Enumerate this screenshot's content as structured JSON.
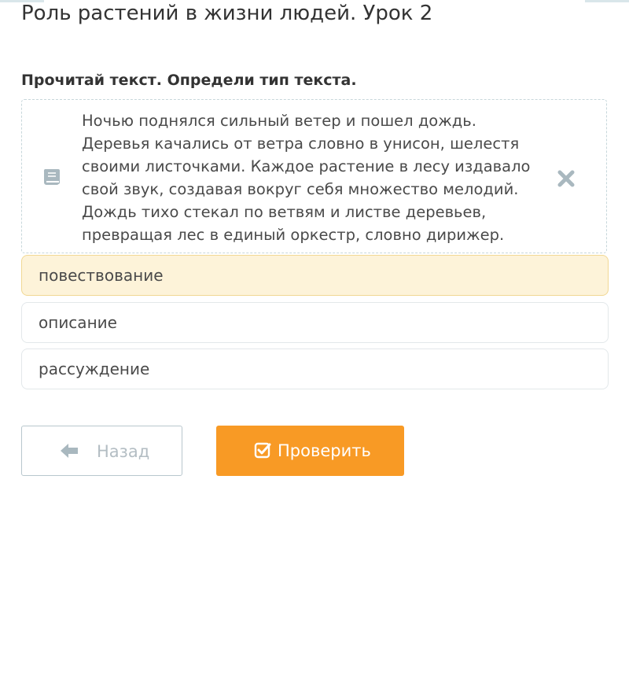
{
  "lesson": {
    "title": "Роль растений в жизни людей. Урок 2"
  },
  "task": {
    "instruction": "Прочитай текст. Определи тип текста.",
    "passage": "Ночью поднялся сильный ветер и пошел дождь. Деревья качались от ветра словно в унисон, шелестя своими листочками. Каждое растение в лесу издавало свой звук, создавая вокруг себя множество мелодий. Дождь тихо стекал по ветвям и листве деревьев, превращая лес в единый оркестр, словно дирижер.",
    "passage_icon": "book-icon",
    "close_icon": "close-icon"
  },
  "options": [
    {
      "label": "повествование",
      "selected": true
    },
    {
      "label": "описание",
      "selected": false
    },
    {
      "label": "рассуждение",
      "selected": false
    }
  ],
  "buttons": {
    "back_label": "Назад",
    "back_icon": "arrow-left-icon",
    "check_label": "Проверить",
    "check_icon": "checkbox-checked-icon"
  },
  "colors": {
    "accent": "#f89a25",
    "selected_option_bg": "#fdf3d9",
    "icon_gray": "#a9b8bf"
  }
}
